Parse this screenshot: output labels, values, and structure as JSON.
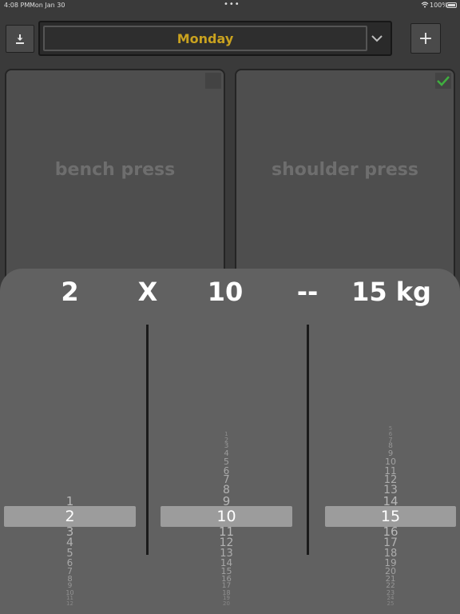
{
  "status_bar": {
    "time": "4:08 PM",
    "date": "Mon Jan 30",
    "battery": "100%"
  },
  "header": {
    "selected_day": "Monday",
    "add_label": "+"
  },
  "cards": [
    {
      "name": "bench press",
      "checked": false
    },
    {
      "name": "shoulder press",
      "checked": true
    }
  ],
  "summary": {
    "sets": "2",
    "x": "X",
    "reps": "10",
    "dash": "--",
    "weight": "15 kg"
  },
  "pickers": {
    "sets": {
      "selected": "2",
      "above": [
        "1"
      ],
      "below": [
        "3",
        "4",
        "5",
        "6",
        "7",
        "8",
        "9",
        "10",
        "11",
        "12"
      ]
    },
    "reps": {
      "selected": "10",
      "above": [
        "1",
        "2",
        "3",
        "4",
        "5",
        "6",
        "7",
        "8",
        "9"
      ],
      "below": [
        "11",
        "12",
        "13",
        "14",
        "15",
        "16",
        "17",
        "18",
        "19",
        "20"
      ]
    },
    "weight": {
      "selected": "15",
      "above": [
        "5",
        "6",
        "7",
        "8",
        "9",
        "10",
        "11",
        "12",
        "13",
        "14"
      ],
      "below": [
        "16",
        "17",
        "18",
        "19",
        "20",
        "21",
        "22",
        "23",
        "24",
        "25"
      ]
    }
  },
  "colors": {
    "accent": "#c9a21f",
    "check": "#3fae3f"
  }
}
